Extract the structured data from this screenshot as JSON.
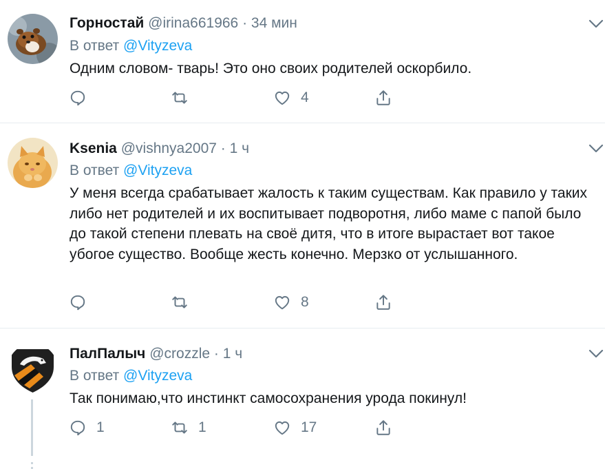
{
  "replies": [
    {
      "name": "Горностай",
      "handle": "@irina661966",
      "time": "34 мин",
      "reply_prefix": "В ответ",
      "reply_to": "@Vityzeva",
      "text": "Одним словом- тварь! Это оно своих родителей оскорбило.",
      "replies_count": "",
      "retweets_count": "",
      "likes_count": "4"
    },
    {
      "name": "Ksenia",
      "handle": "@vishnya2007",
      "time": "1 ч",
      "reply_prefix": "В ответ",
      "reply_to": "@Vityzeva",
      "text": "У меня всегда срабатывает жалость к таким существам. Как правило у таких либо нет родителей и их воспитывает подворотня, либо маме с папой было до такой степени плевать на своё дитя, что в итоге вырастает вот такое убогое существо. Вообще жесть конечно. Мерзко от услышанного.",
      "replies_count": "",
      "retweets_count": "",
      "likes_count": "8"
    },
    {
      "name": "ПалПалыч",
      "handle": "@crozzle",
      "time": "1 ч",
      "reply_prefix": "В ответ",
      "reply_to": "@Vityzeva",
      "text": "Так понимаю,что инстинкт самосохранения урода покинул!",
      "replies_count": "1",
      "retweets_count": "1",
      "likes_count": "17"
    }
  ],
  "separator": " · ",
  "icons": {
    "reply": "speech-bubble-icon",
    "retweet": "retweet-arrows-icon",
    "like": "heart-outline-icon",
    "share": "share-upload-icon",
    "menu": "chevron-down-icon"
  },
  "colors": {
    "text": "#14171a",
    "secondary": "#657786",
    "link": "#1da1f2",
    "divider": "#e6ecf0"
  }
}
